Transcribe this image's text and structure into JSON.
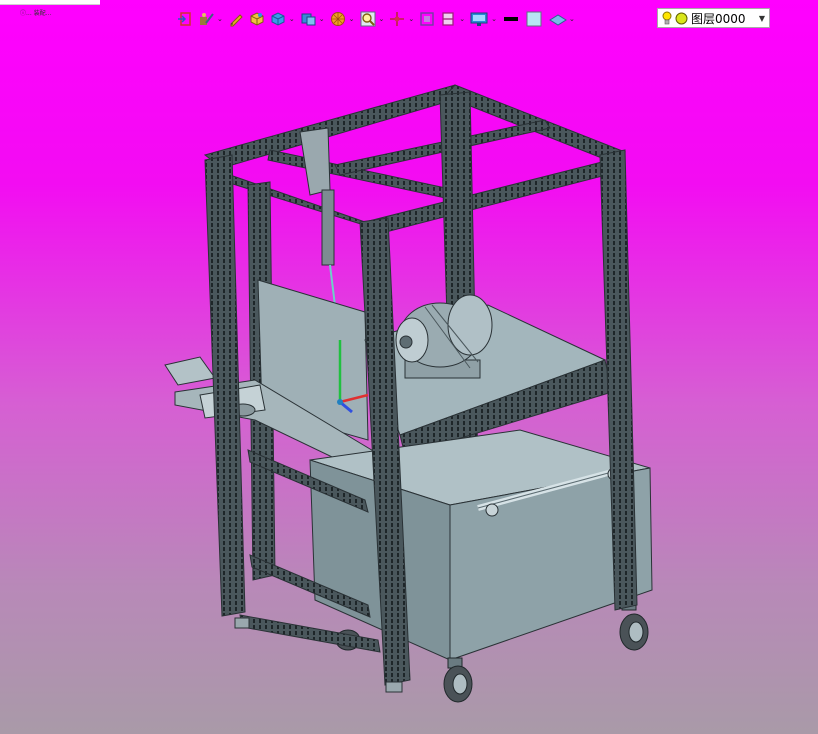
{
  "app": {
    "title_fragment": "ⓘ... 装配..."
  },
  "toolbar": {
    "icons": [
      "exit-sketch-icon",
      "sketch-draw-icon",
      "pencil-icon",
      "solid-box-icon",
      "extrude-icon",
      "view-orient-icon",
      "render-ball-icon",
      "zoom-window-icon",
      "pan-axis-icon",
      "fit-frame-icon",
      "section-view-icon",
      "display-monitor-icon",
      "line-weight-icon",
      "color-swatch-icon",
      "surface-icon"
    ],
    "layer_label": "图层0000",
    "bulb_color": "#ffe600",
    "layer_dot_color": "#d9e61a"
  },
  "viewport": {
    "background_top": "#ff00ff",
    "background_bottom": "#a99aa8",
    "model_color": "#8fa5ad",
    "frame_color": "#3b4549"
  }
}
